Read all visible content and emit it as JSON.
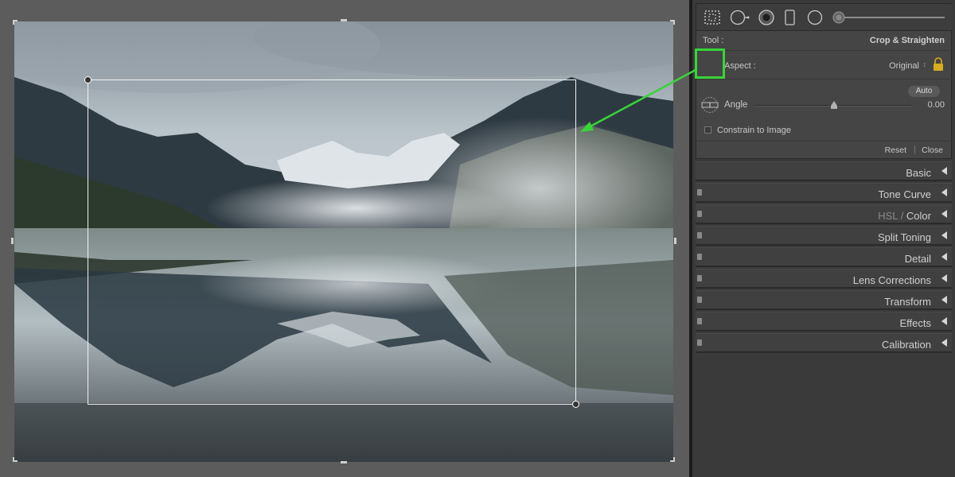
{
  "panel": {
    "tool_label": "Tool :",
    "tool_name": "Crop & Straighten",
    "aspect_label": "Aspect :",
    "aspect_value": "Original",
    "aspect_arrows": "↕",
    "auto_label": "Auto",
    "angle_label": "Angle",
    "angle_value": "0.00",
    "constrain_label": "Constrain to Image",
    "reset_label": "Reset",
    "close_separator": "|",
    "close_label": "Close"
  },
  "sections": [
    {
      "title": "Basic",
      "has_switch": false
    },
    {
      "title": "Tone Curve",
      "has_switch": true
    },
    {
      "title_dim": "HSL",
      "title_sep": " / ",
      "title": "Color",
      "has_switch": true
    },
    {
      "title": "Split Toning",
      "has_switch": true
    },
    {
      "title": "Detail",
      "has_switch": true
    },
    {
      "title": "Lens Corrections",
      "has_switch": true
    },
    {
      "title": "Transform",
      "has_switch": true
    },
    {
      "title": "Effects",
      "has_switch": true
    },
    {
      "title": "Calibration",
      "has_switch": true
    }
  ],
  "toolstrip_icons": [
    "crop-overlay-icon",
    "spot-removal-icon",
    "red-eye-icon",
    "graduated-filter-icon",
    "radial-filter-icon",
    "adjustment-brush-icon"
  ],
  "colors": {
    "highlight": "#39d43a",
    "panel_bg": "#3a3a3a",
    "section_bg": "#404040"
  }
}
